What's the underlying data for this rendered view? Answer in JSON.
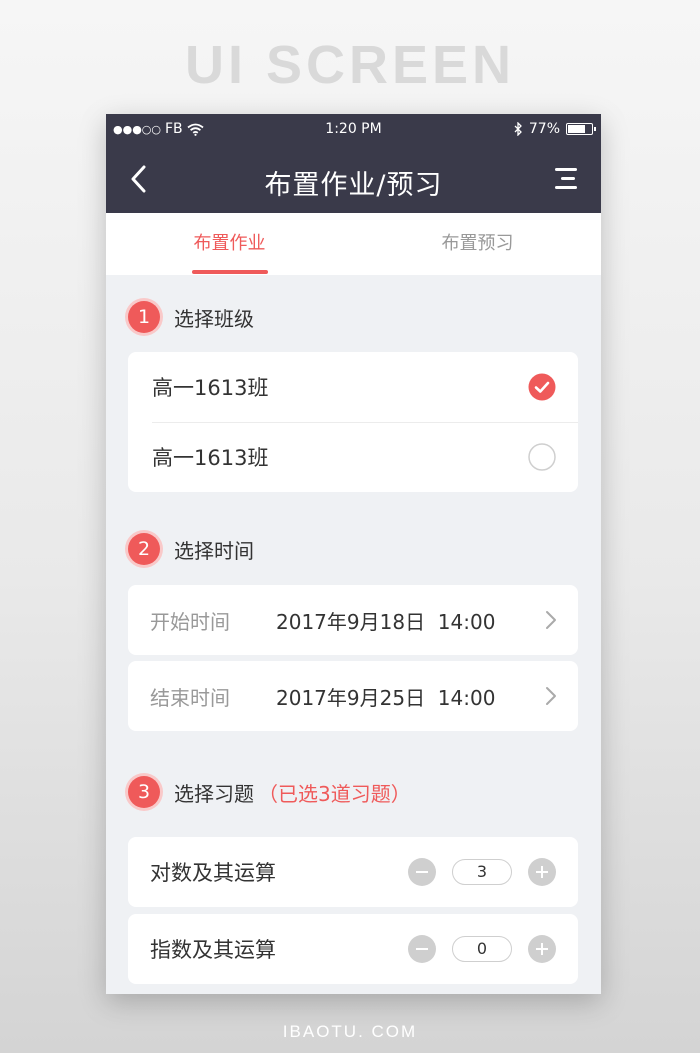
{
  "page": {
    "heading": "UI SCREEN",
    "credit": "IBAOTU. COM"
  },
  "status_bar": {
    "carrier": "FB",
    "time": "1:20 PM",
    "battery": "77%",
    "battery_level": 0.77,
    "icons": [
      "signal-dots-icon",
      "wifi-icon",
      "bluetooth-icon",
      "battery-icon"
    ]
  },
  "nav": {
    "title": "布置作业/预习",
    "back_icon": "chevron-left-icon",
    "menu_icon": "menu-icon"
  },
  "tabs": [
    {
      "label": "布置作业",
      "active": true
    },
    {
      "label": "布置预习",
      "active": false
    }
  ],
  "sections": {
    "class": {
      "number": "1",
      "title": "选择班级",
      "items": [
        {
          "label": "高一1613班",
          "selected": true
        },
        {
          "label": "高一1613班",
          "selected": false
        }
      ]
    },
    "time": {
      "number": "2",
      "title": "选择时间",
      "rows": [
        {
          "label": "开始时间",
          "value": "2017年9月18日  14:00"
        },
        {
          "label": "结束时间",
          "value": "2017年9月25日  14:00"
        }
      ]
    },
    "exercise": {
      "number": "3",
      "title": "选择习题",
      "note": "（已选3道习题）",
      "items": [
        {
          "label": "对数及其运算",
          "count": "3"
        },
        {
          "label": "指数及其运算",
          "count": "0"
        }
      ]
    }
  },
  "colors": {
    "accent": "#ef5a5a",
    "header_bg": "#3a3a4a",
    "page_bg": "#eff1f4"
  }
}
